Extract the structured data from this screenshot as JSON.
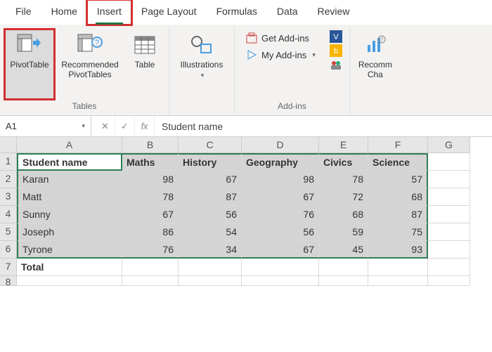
{
  "tabs": {
    "file": "File",
    "home": "Home",
    "insert": "Insert",
    "pagelayout": "Page Layout",
    "formulas": "Formulas",
    "data": "Data",
    "review": "Review"
  },
  "ribbon": {
    "tables_label": "Tables",
    "pivottable": "PivotTable",
    "recommended": "Recommended PivotTables",
    "table": "Table",
    "illustrations": "Illustrations",
    "addins_label": "Add-ins",
    "get_addins": "Get Add-ins",
    "my_addins": "My Add-ins",
    "recomm": "Recomm",
    "cha": "Cha"
  },
  "namebox": "A1",
  "formula_value": "Student name",
  "cols": [
    "A",
    "B",
    "C",
    "D",
    "E",
    "F",
    "G"
  ],
  "headers": [
    "Student name",
    "Maths",
    "History",
    "Geography",
    "Civics",
    "Science"
  ],
  "rows": [
    {
      "name": "Karan",
      "vals": [
        98,
        67,
        98,
        78,
        57
      ]
    },
    {
      "name": "Matt",
      "vals": [
        78,
        87,
        67,
        72,
        68
      ]
    },
    {
      "name": "Sunny",
      "vals": [
        67,
        56,
        76,
        68,
        87
      ]
    },
    {
      "name": "Joseph",
      "vals": [
        86,
        54,
        56,
        59,
        75
      ]
    },
    {
      "name": "Tyrone",
      "vals": [
        76,
        34,
        67,
        45,
        93
      ]
    }
  ],
  "total": "Total"
}
